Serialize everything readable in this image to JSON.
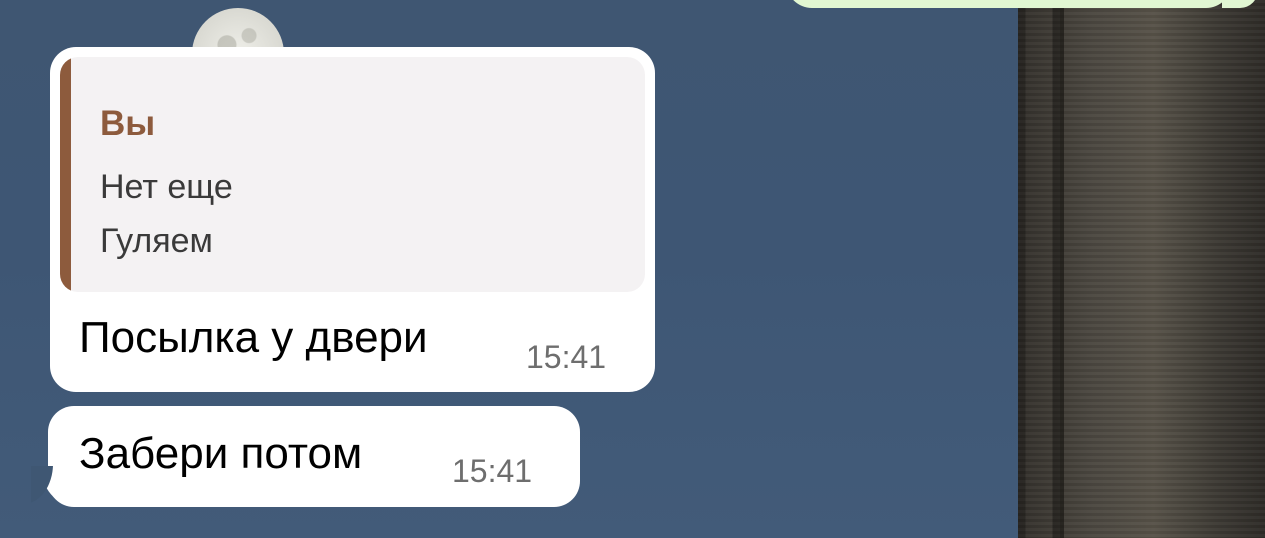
{
  "chat": {
    "messages": [
      {
        "direction": "incoming",
        "reply": {
          "author": "Вы",
          "lines": [
            "Нет еще",
            "Гуляем"
          ],
          "accent_color": "#8d5b3d"
        },
        "text": "Посылка у двери",
        "time": "15:41"
      },
      {
        "direction": "incoming",
        "text": "Забери потом",
        "time": "15:41"
      }
    ]
  },
  "colors": {
    "incoming_bubble": "#ffffff",
    "outgoing_bubble": "#e1f7d2",
    "time_text": "#6e6e6e",
    "background": "#3f5773"
  }
}
